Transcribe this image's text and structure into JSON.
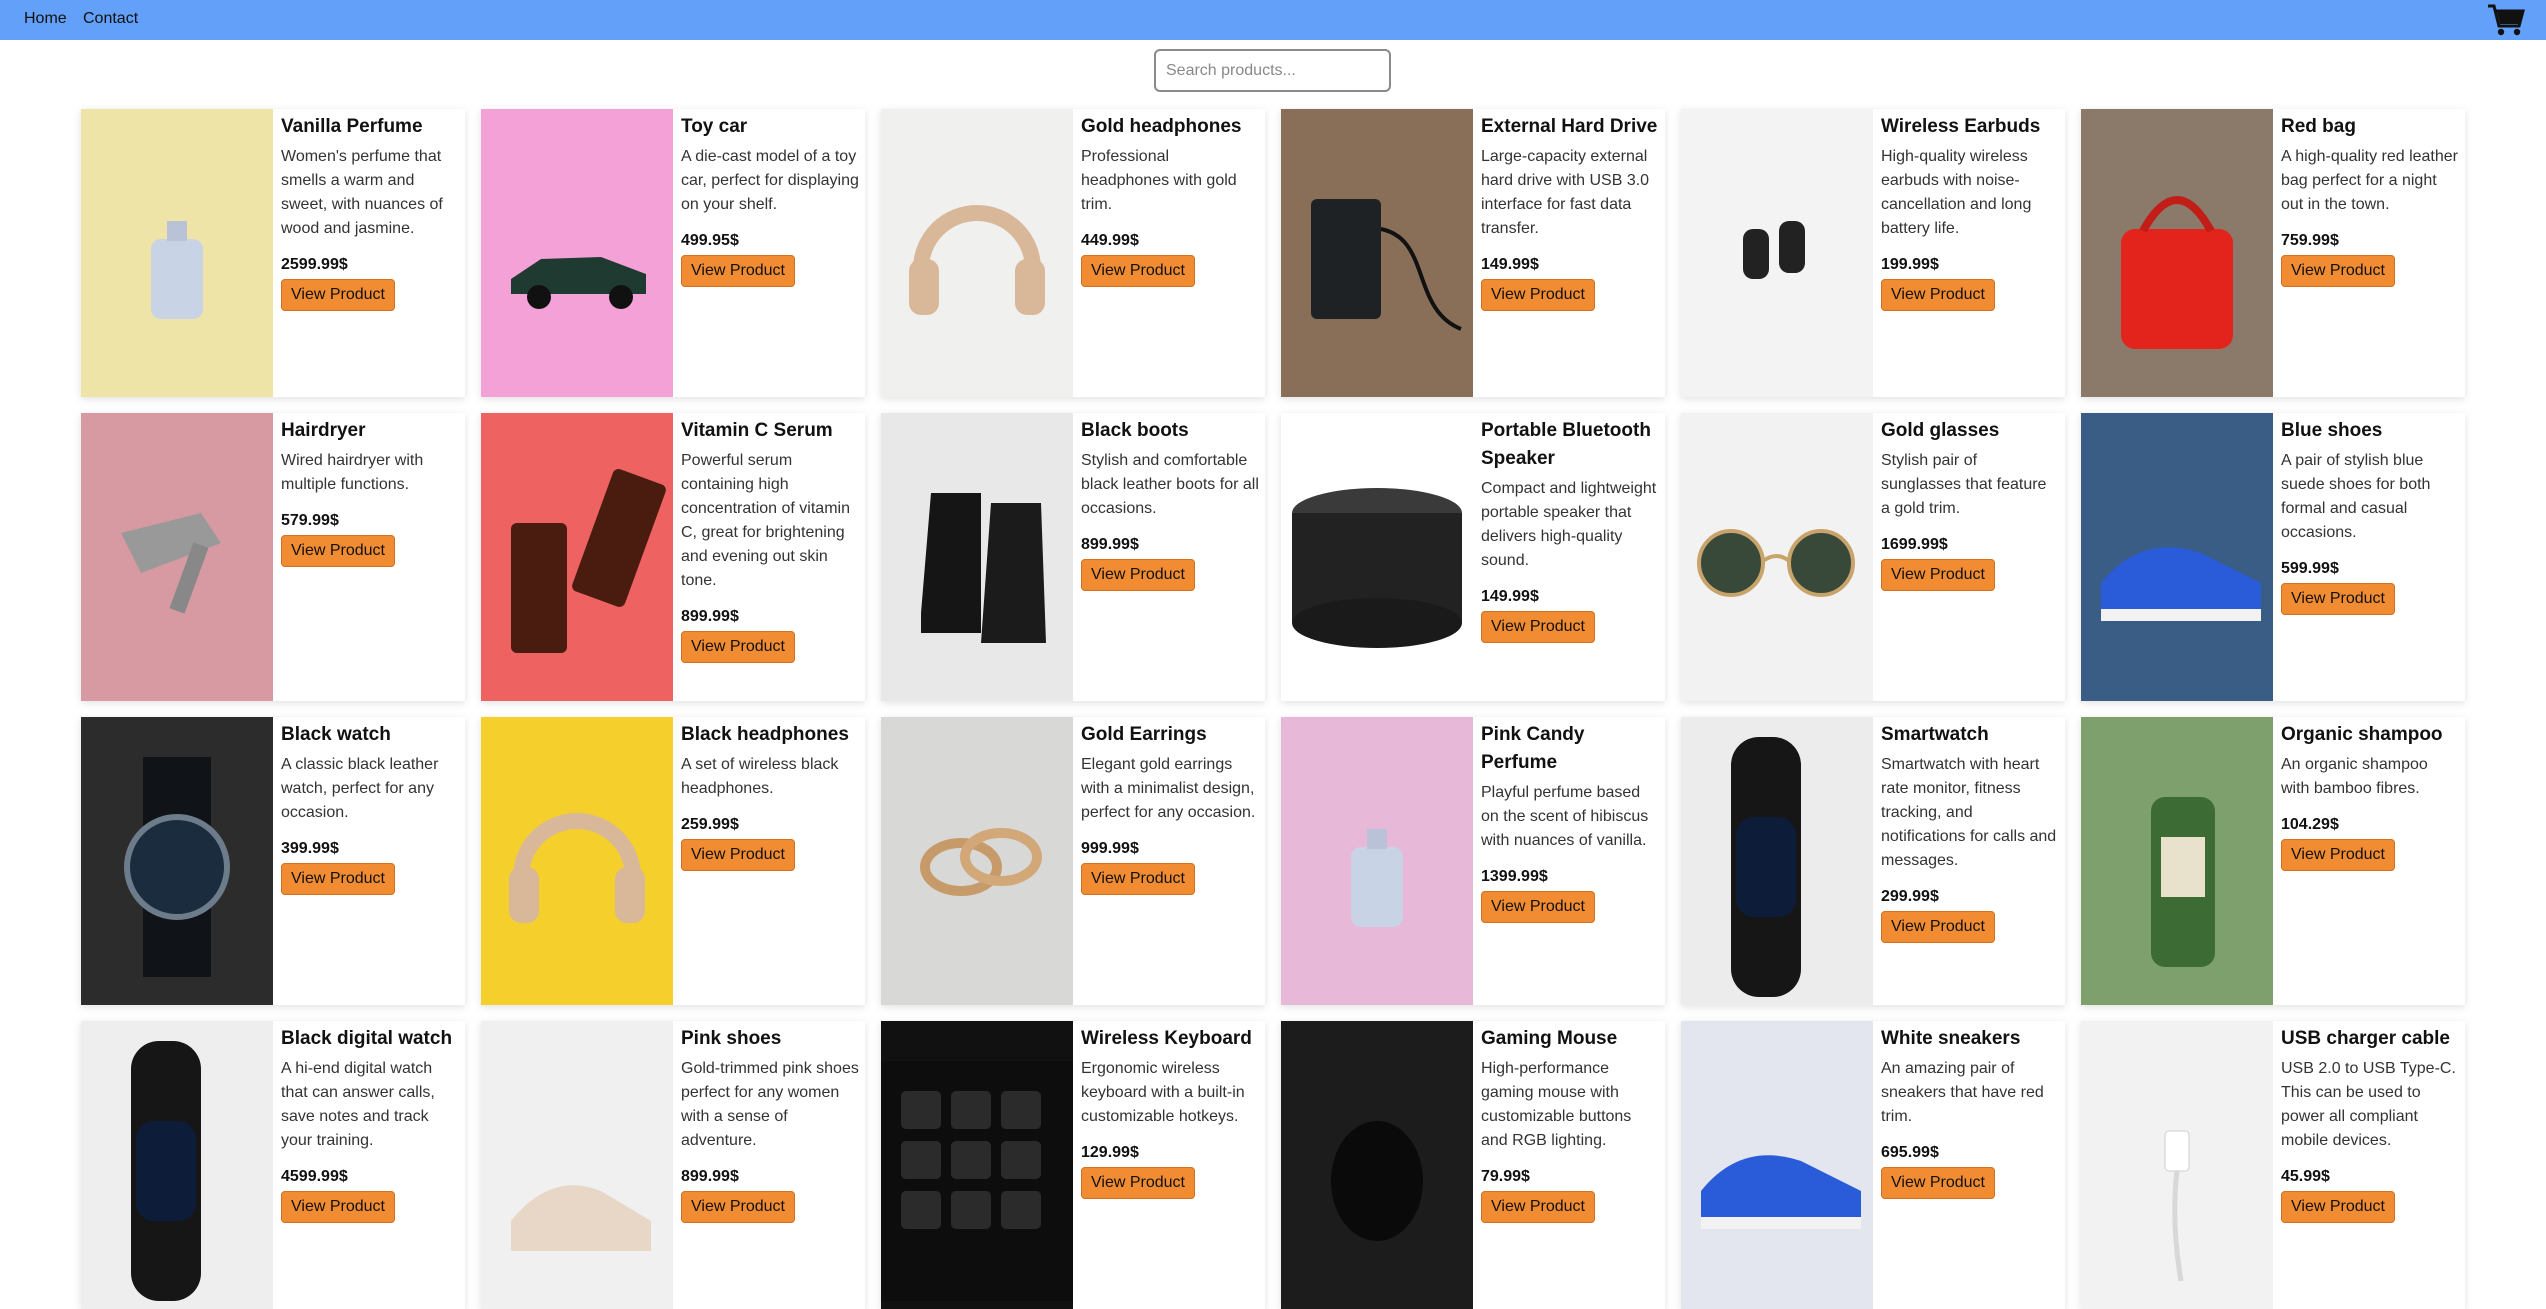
{
  "nav": {
    "home": "Home",
    "contact": "Contact"
  },
  "search": {
    "placeholder": "Search products..."
  },
  "button_label": "View Product",
  "products": [
    {
      "title": "Vanilla Perfume",
      "desc": "Women's perfume that smells a warm and sweet, with nuances of wood and jasmine.",
      "price": "2599.99$"
    },
    {
      "title": "Toy car",
      "desc": "A die-cast model of a toy car, perfect for displaying on your shelf.",
      "price": "499.95$"
    },
    {
      "title": "Gold headphones",
      "desc": "Professional headphones with gold trim.",
      "price": "449.99$"
    },
    {
      "title": "External Hard Drive",
      "desc": "Large-capacity external hard drive with USB 3.0 interface for fast data transfer.",
      "price": "149.99$"
    },
    {
      "title": "Wireless Earbuds",
      "desc": "High-quality wireless earbuds with noise-cancellation and long battery life.",
      "price": "199.99$"
    },
    {
      "title": "Red bag",
      "desc": "A high-quality red leather bag perfect for a night out in the town.",
      "price": "759.99$"
    },
    {
      "title": "Hairdryer",
      "desc": "Wired hairdryer with multiple functions.",
      "price": "579.99$"
    },
    {
      "title": "Vitamin C Serum",
      "desc": "Powerful serum containing high concentration of vitamin C, great for brightening and evening out skin tone.",
      "price": "899.99$"
    },
    {
      "title": "Black boots",
      "desc": "Stylish and comfortable black leather boots for all occasions.",
      "price": "899.99$"
    },
    {
      "title": "Portable Bluetooth Speaker",
      "desc": "Compact and lightweight portable speaker that delivers high-quality sound.",
      "price": "149.99$"
    },
    {
      "title": "Gold glasses",
      "desc": "Stylish pair of sunglasses that feature a gold trim.",
      "price": "1699.99$"
    },
    {
      "title": "Blue shoes",
      "desc": "A pair of stylish blue suede shoes for both formal and casual occasions.",
      "price": "599.99$"
    },
    {
      "title": "Black watch",
      "desc": "A classic black leather watch, perfect for any occasion.",
      "price": "399.99$"
    },
    {
      "title": "Black headphones",
      "desc": "A set of wireless black headphones.",
      "price": "259.99$"
    },
    {
      "title": "Gold Earrings",
      "desc": "Elegant gold earrings with a minimalist design, perfect for any occasion.",
      "price": "999.99$"
    },
    {
      "title": "Pink Candy Perfume",
      "desc": "Playful perfume based on the scent of hibiscus with nuances of vanilla.",
      "price": "1399.99$"
    },
    {
      "title": "Smartwatch",
      "desc": "Smartwatch with heart rate monitor, fitness tracking, and notifications for calls and messages.",
      "price": "299.99$"
    },
    {
      "title": "Organic shampoo",
      "desc": "An organic shampoo with bamboo fibres.",
      "price": "104.29$"
    },
    {
      "title": "Black digital watch",
      "desc": "A hi-end digital watch that can answer calls, save notes and track your training.",
      "price": "4599.99$"
    },
    {
      "title": "Pink shoes",
      "desc": "Gold-trimmed pink shoes perfect for any women with a sense of adventure.",
      "price": "899.99$"
    },
    {
      "title": "Wireless Keyboard",
      "desc": "Ergonomic wireless keyboard with a built-in customizable hotkeys.",
      "price": "129.99$"
    },
    {
      "title": "Gaming Mouse",
      "desc": "High-performance gaming mouse with customizable buttons and RGB lighting.",
      "price": "79.99$"
    },
    {
      "title": "White sneakers",
      "desc": "An amazing pair of sneakers that have red trim.",
      "price": "695.99$"
    },
    {
      "title": "USB charger cable",
      "desc": "USB 2.0 to USB Type-C. This can be used to power all compliant mobile devices.",
      "price": "45.99$"
    }
  ],
  "image_icons": [
    "perfume-bottle-icon",
    "toy-car-icon",
    "headphones-icon",
    "hard-drive-icon",
    "earbuds-icon",
    "handbag-icon",
    "hairdryer-icon",
    "serum-bottle-icon",
    "boots-icon",
    "speaker-icon",
    "sunglasses-icon",
    "sneaker-icon",
    "watch-icon",
    "headphones-icon",
    "earrings-icon",
    "perfume-bottle-icon",
    "smartwatch-icon",
    "shampoo-bottle-icon",
    "smartwatch-icon",
    "shoes-icon",
    "keyboard-icon",
    "mouse-icon",
    "sneaker-icon",
    "usb-cable-icon"
  ],
  "image_backgrounds": [
    "#efe4a8",
    "#f4a1d8",
    "#f0f0ee",
    "#8a6f58",
    "#f3f3f3",
    "#8b7a6a",
    "#d79aa3",
    "#ef6262",
    "#e8e8e8",
    "#ffffff",
    "#f2f2f2",
    "#3a5d86",
    "#2c2c2c",
    "#f5cf2c",
    "#d8d8d6",
    "#e8b8d8",
    "#ececec",
    "#7da06c",
    "#eeeeee",
    "#f0f0f0",
    "#111111",
    "#1c1c1c",
    "#e3e6ee",
    "#f2f2f2"
  ],
  "colors": {
    "navbar": "#62a0fa",
    "button": "#f28c33"
  }
}
